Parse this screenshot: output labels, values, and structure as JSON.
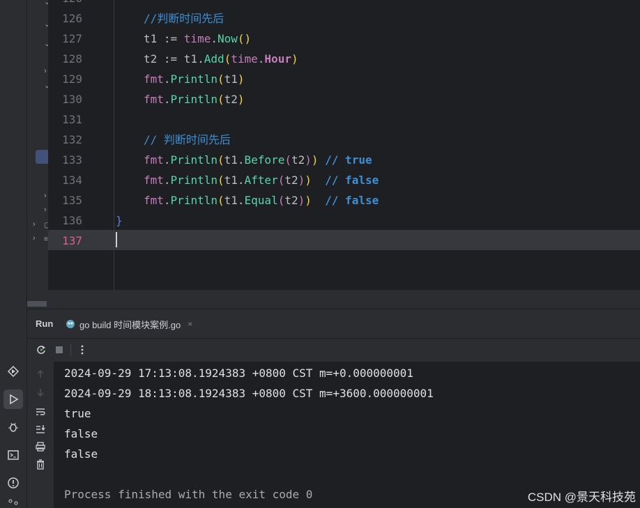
{
  "editor": {
    "lines": [
      {
        "n": "126"
      },
      {
        "n": "127"
      },
      {
        "n": "128"
      },
      {
        "n": "129"
      },
      {
        "n": "130"
      },
      {
        "n": "131"
      },
      {
        "n": "132"
      },
      {
        "n": "133"
      },
      {
        "n": "134"
      },
      {
        "n": "135"
      },
      {
        "n": "136"
      },
      {
        "n": "137"
      }
    ],
    "comment_126": "//判断时间先后",
    "comment_132": "// 判断时间先后",
    "t1": "t1",
    "t2": "t2",
    "assign": " := ",
    "time": "time",
    "now": "Now",
    "add": "Add",
    "hour": "Hour",
    "fmt": "fmt",
    "println": "Println",
    "before": "Before",
    "after": "After",
    "equal": "Equal",
    "cmt_true": "// true",
    "cmt_false": "// false",
    "close_brace": "}"
  },
  "run_panel": {
    "title": "Run",
    "tab_label": "go build 时间模块案例.go",
    "tab_close": "×",
    "output": [
      "2024-09-29 17:13:08.1924383 +0800 CST m=+0.000000001",
      "2024-09-29 18:13:08.1924383 +0800 CST m=+3600.000000001",
      "true",
      "false",
      "false",
      "",
      "Process finished with the exit code 0"
    ]
  },
  "watermark": "CSDN @景天科技苑",
  "colors": {
    "accent": "#3574f0",
    "editor_bg": "#1e1f22",
    "line_number_current": "#e05e8f"
  },
  "icons": {
    "tool_strip": [
      "services-icon",
      "run-icon",
      "debug-icon",
      "terminal-icon",
      "problems-icon",
      "git-icon"
    ],
    "run_toolbar": [
      "rerun-icon",
      "stop-icon",
      "more-icon"
    ],
    "run_side": [
      "up-arrow-icon",
      "down-arrow-icon",
      "soft-wrap-icon",
      "scroll-to-end-icon",
      "print-icon",
      "trash-icon"
    ]
  }
}
